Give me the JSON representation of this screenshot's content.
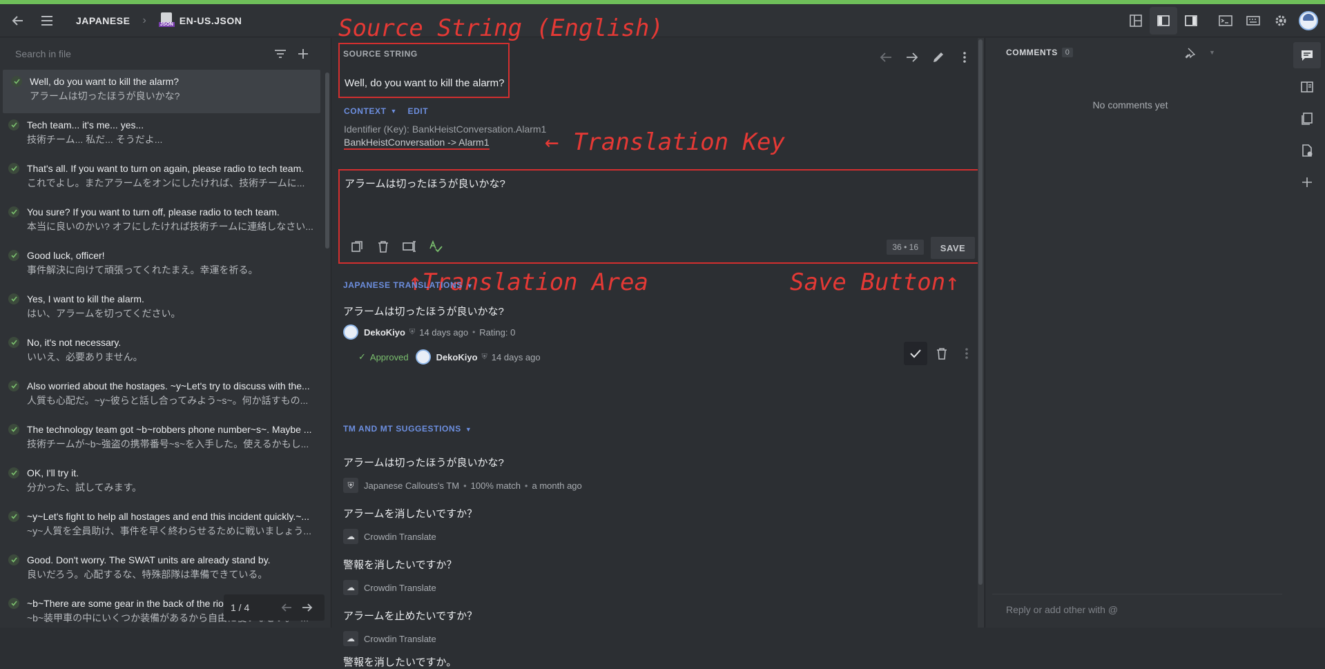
{
  "topbar": {
    "breadcrumb_project": "JAPANESE",
    "breadcrumb_file": "EN-US.JSON",
    "file_badge": "JSON"
  },
  "left": {
    "search_placeholder": "Search in file",
    "pager": "1 / 4",
    "strings": [
      {
        "src": "Well, do you want to kill the alarm?",
        "tr": "アラームは切ったほうが良いかな?"
      },
      {
        "src": "Tech team... it's me... yes...",
        "tr": "技術チーム... 私だ... そうだよ..."
      },
      {
        "src": "That's all. If you want to turn on again, please radio to tech team.",
        "tr": "これでよし。またアラームをオンにしたければ、技術チームに..."
      },
      {
        "src": "You sure? If you want to turn off, please radio to tech team.",
        "tr": "本当に良いのかい? オフにしたければ技術チームに連絡しなさい..."
      },
      {
        "src": "Good luck, officer!",
        "tr": "事件解決に向けて頑張ってくれたまえ。幸運を祈る。"
      },
      {
        "src": "Yes, I want to kill the alarm.",
        "tr": "はい、アラームを切ってください。"
      },
      {
        "src": "No, it's not necessary.",
        "tr": "いいえ、必要ありません。"
      },
      {
        "src": "Also worried about the hostages. ~y~Let's try to discuss with the...",
        "tr": "人質も心配だ。~y~彼らと話し合ってみよう~s~。何か話すもの..."
      },
      {
        "src": "The technology team got ~b~robbers phone number~s~. Maybe ...",
        "tr": "技術チームが~b~強盗の携帯番号~s~を入手した。使えるかもし..."
      },
      {
        "src": "OK, I'll try it.",
        "tr": "分かった、試してみます。"
      },
      {
        "src": "~y~Let's fight to help all hostages and end this incident quickly.~...",
        "tr": "~y~人質を全員助け、事件を早く終わらせるために戦いましょう..."
      },
      {
        "src": "Good. Don't worry. The SWAT units are already stand by.",
        "tr": "良いだろう。心配するな、特殊部隊は準備できている。"
      },
      {
        "src": "~b~There are some gear in the back of the riot vans~s~",
        "tr": "~b~装甲車の中にいくつか装備があるから自由に使いなさい。~..."
      }
    ]
  },
  "center": {
    "source_label": "SOURCE STRING",
    "source_text": "Well, do you want to kill the alarm?",
    "context_label": "CONTEXT",
    "edit_label": "EDIT",
    "identifier": "Identifier (Key): BankHeistConversation.Alarm1",
    "key_path": "BankHeistConversation -> Alarm1",
    "translation_text": "アラームは切ったほうが良いかな?",
    "counter": "36 • 16",
    "save_label": "SAVE",
    "annotations": {
      "source": "Source String (English)",
      "key": "← Translation Key",
      "area": "↑Translation Area",
      "save": "Save Button↑"
    },
    "jp_label": "JAPANESE TRANSLATIONS",
    "jp_translation": {
      "text": "アラームは切ったほうが良いかな?",
      "user": "DekoKiyo",
      "time": "14 days ago",
      "rating": "Rating: 0",
      "approved_label": "Approved",
      "approver": "DekoKiyo",
      "approved_time": "14 days ago"
    },
    "tm_label": "TM AND MT SUGGESTIONS",
    "suggestions": [
      {
        "text": "アラームは切ったほうが良いかな?",
        "source": "Japanese Callouts's TM",
        "match": "100% match",
        "time": "a month ago"
      },
      {
        "text": "アラームを消したいですか？",
        "source": "Crowdin Translate"
      },
      {
        "text": "警報を消したいですか？",
        "source": "Crowdin Translate"
      },
      {
        "text": "アラームを止めたいですか？",
        "source": "Crowdin Translate"
      },
      {
        "text": "警報を消したいですか。",
        "source": ""
      }
    ]
  },
  "comments": {
    "title": "COMMENTS",
    "count": "0",
    "empty": "No comments yet",
    "reply_placeholder": "Reply or add other with @"
  }
}
